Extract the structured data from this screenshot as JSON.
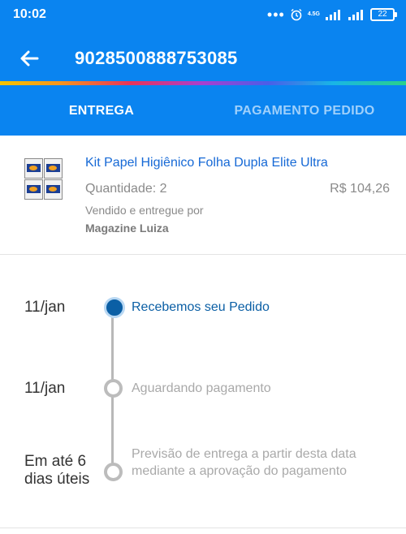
{
  "status_bar": {
    "time": "10:02",
    "dots": "•••",
    "network": "4.5G",
    "battery": "22"
  },
  "header": {
    "order_number": "9028500888753085"
  },
  "tabs": [
    {
      "label": "ENTREGA",
      "active": true
    },
    {
      "label": "PAGAMENTO PEDIDO",
      "active": false
    }
  ],
  "product": {
    "name": "Kit Papel Higiênico Folha Dupla Elite Ultra",
    "quantity": "Quantidade: 2",
    "price": "R$ 104,26",
    "sold_by_label": "Vendido e entregue por",
    "seller": "Magazine Luiza"
  },
  "timeline": [
    {
      "date": "11/jan",
      "text": "Recebemos seu Pedido",
      "state": "done"
    },
    {
      "date": "11/jan",
      "text": "Aguardando pagamento",
      "state": "pending"
    },
    {
      "date_line1": "Em até 6",
      "date_line2": "dias úteis",
      "text": "Previsão de entrega a partir desta data mediante a aprovação do pagamento",
      "state": "pending"
    }
  ],
  "colors": {
    "primary": "#0a84f0",
    "link": "#1669d6",
    "done_dot": "#0b5fa5",
    "muted": "#a9a9a9"
  }
}
